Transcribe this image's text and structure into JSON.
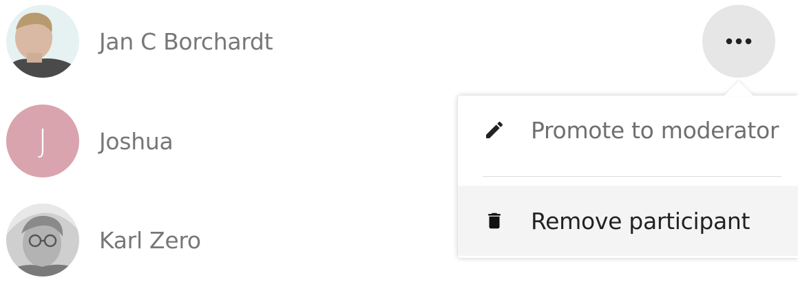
{
  "participants": [
    {
      "name": "Jan C Borchardt",
      "avatar": "photo"
    },
    {
      "name": "Joshua",
      "avatar": "letter",
      "initial": "J",
      "color": "#d9a4ad"
    },
    {
      "name": "Karl Zero",
      "avatar": "photo"
    }
  ],
  "more_button": {
    "icon": "more-horizontal-icon"
  },
  "menu": {
    "items": [
      {
        "label": "Promote to moderator",
        "icon": "pencil-icon"
      },
      {
        "label": "Remove participant",
        "icon": "trash-icon",
        "highlighted": true
      }
    ]
  }
}
